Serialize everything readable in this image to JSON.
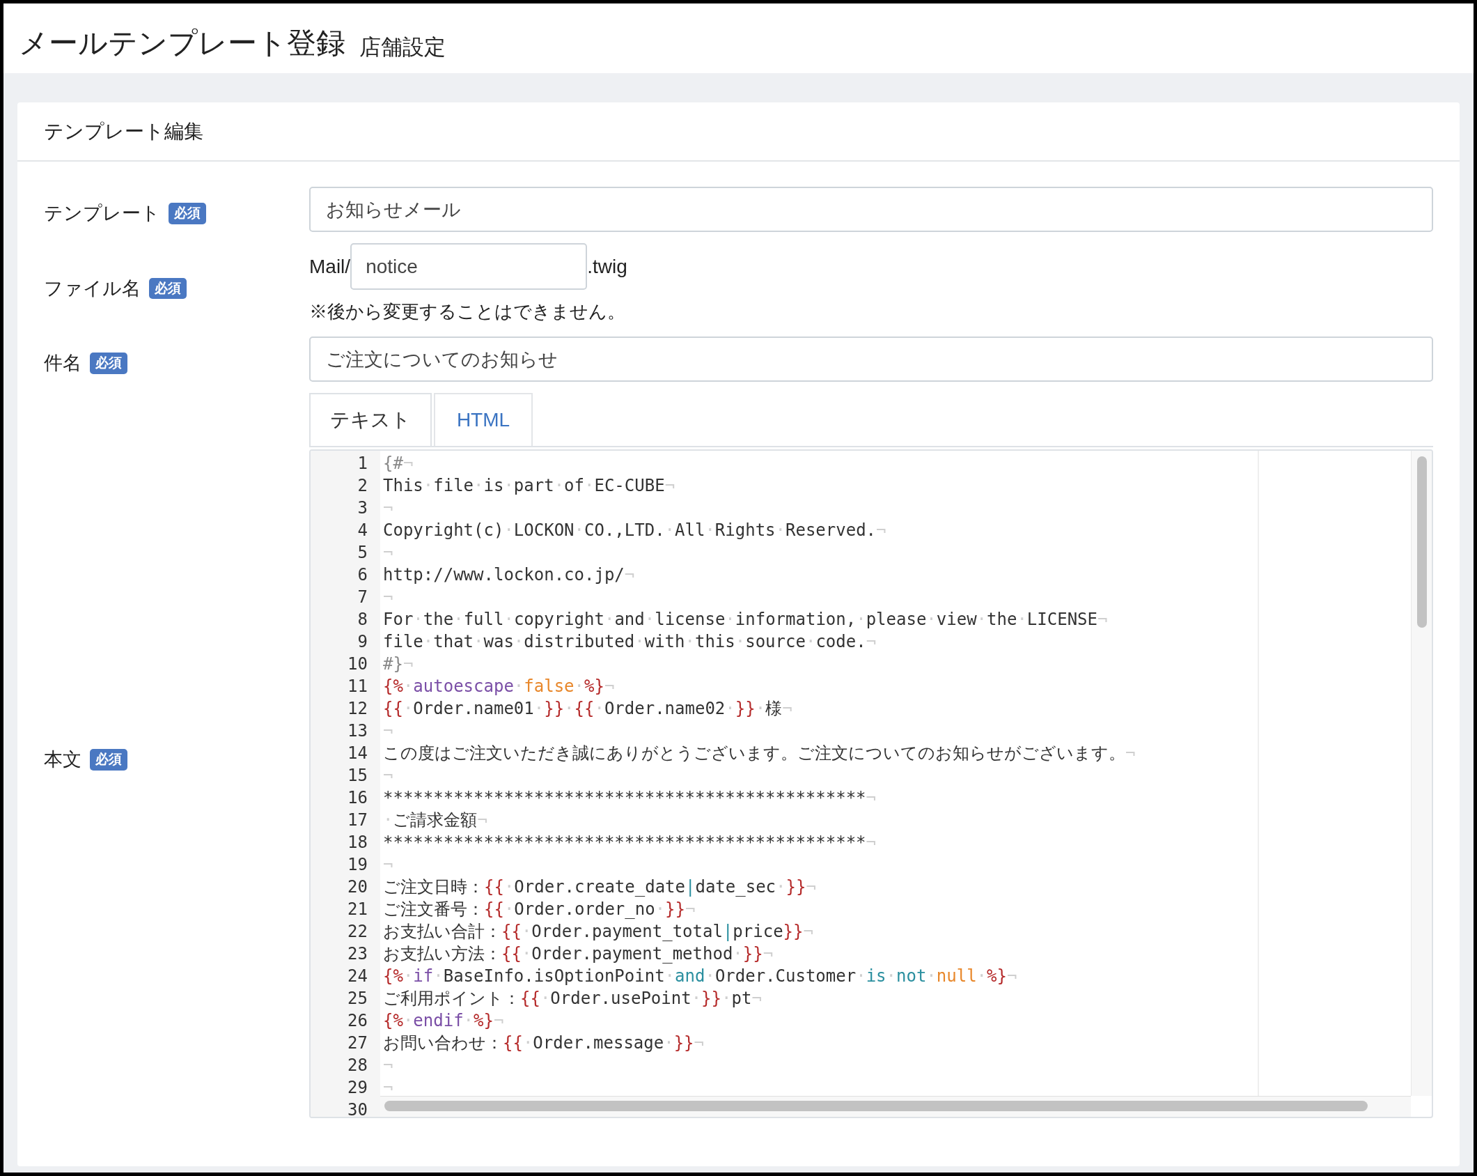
{
  "header": {
    "title": "メールテンプレート登録",
    "subtitle": "店舗設定"
  },
  "card": {
    "title": "テンプレート編集"
  },
  "form": {
    "template": {
      "label": "テンプレート",
      "badge": "必須",
      "value": "お知らせメール"
    },
    "file_name": {
      "label": "ファイル名",
      "badge": "必須",
      "prefix": "Mail/",
      "value": "notice",
      "suffix": ".twig",
      "note": "※後から変更することはできません。"
    },
    "subject": {
      "label": "件名",
      "badge": "必須",
      "value": "ご注文についてのお知らせ"
    },
    "body": {
      "label": "本文",
      "badge": "必須",
      "tabs": [
        {
          "label": "テキスト",
          "selected": true
        },
        {
          "label": "HTML",
          "selected": false
        }
      ],
      "editor": {
        "lines": [
          {
            "number": "1",
            "tokens": [
              {
                "kind": "comment",
                "text": "{#"
              },
              {
                "kind": "plain",
                "text": "¬"
              }
            ]
          },
          {
            "number": "2",
            "tokens": [
              {
                "kind": "plain",
                "text": "This·file·is·part·of·EC-CUBE¬"
              }
            ]
          },
          {
            "number": "3",
            "tokens": [
              {
                "kind": "plain",
                "text": "¬"
              }
            ]
          },
          {
            "number": "4",
            "tokens": [
              {
                "kind": "plain",
                "text": "Copyright(c)·LOCKON·CO.,LTD.·All·Rights·Reserved.¬"
              }
            ]
          },
          {
            "number": "5",
            "tokens": [
              {
                "kind": "plain",
                "text": "¬"
              }
            ]
          },
          {
            "number": "6",
            "tokens": [
              {
                "kind": "plain",
                "text": "http://www.lockon.co.jp/¬"
              }
            ]
          },
          {
            "number": "7",
            "tokens": [
              {
                "kind": "plain",
                "text": "¬"
              }
            ]
          },
          {
            "number": "8",
            "tokens": [
              {
                "kind": "plain",
                "text": "For·the·full·copyright·and·license·information,·please·view·the·LICENSE¬"
              }
            ]
          },
          {
            "number": "9",
            "tokens": [
              {
                "kind": "plain",
                "text": "file·that·was·distributed·with·this·source·code.¬"
              }
            ]
          },
          {
            "number": "10",
            "tokens": [
              {
                "kind": "comment",
                "text": "#}"
              },
              {
                "kind": "plain",
                "text": "¬"
              }
            ]
          },
          {
            "number": "11",
            "tokens": [
              {
                "kind": "delimiter",
                "text": "{%"
              },
              {
                "kind": "plain",
                "text": "·"
              },
              {
                "kind": "keyword",
                "text": "autoescape"
              },
              {
                "kind": "plain",
                "text": "·"
              },
              {
                "kind": "literal",
                "text": "false"
              },
              {
                "kind": "plain",
                "text": "·"
              },
              {
                "kind": "delimiter",
                "text": "%}"
              },
              {
                "kind": "plain",
                "text": "¬"
              }
            ]
          },
          {
            "number": "12",
            "tokens": [
              {
                "kind": "delimiter",
                "text": "{{"
              },
              {
                "kind": "plain",
                "text": "·Order.name01·"
              },
              {
                "kind": "delimiter",
                "text": "}}"
              },
              {
                "kind": "plain",
                "text": "·"
              },
              {
                "kind": "delimiter",
                "text": "{{"
              },
              {
                "kind": "plain",
                "text": "·Order.name02·"
              },
              {
                "kind": "delimiter",
                "text": "}}"
              },
              {
                "kind": "plain",
                "text": "·様¬"
              }
            ]
          },
          {
            "number": "13",
            "tokens": [
              {
                "kind": "plain",
                "text": "¬"
              }
            ]
          },
          {
            "number": "14",
            "tokens": [
              {
                "kind": "plain",
                "text": "この度はご注文いただき誠にありがとうございます。ご注文についてのお知らせがございます。¬"
              }
            ]
          },
          {
            "number": "15",
            "tokens": [
              {
                "kind": "plain",
                "text": "¬"
              }
            ]
          },
          {
            "number": "16",
            "tokens": [
              {
                "kind": "plain",
                "text": "************************************************¬"
              }
            ]
          },
          {
            "number": "17",
            "tokens": [
              {
                "kind": "plain",
                "text": "·ご請求金額¬"
              }
            ]
          },
          {
            "number": "18",
            "tokens": [
              {
                "kind": "plain",
                "text": "************************************************¬"
              }
            ]
          },
          {
            "number": "19",
            "tokens": [
              {
                "kind": "plain",
                "text": "¬"
              }
            ]
          },
          {
            "number": "20",
            "tokens": [
              {
                "kind": "plain",
                "text": "ご注文日時："
              },
              {
                "kind": "delimiter",
                "text": "{{"
              },
              {
                "kind": "plain",
                "text": "·Order.create_date"
              },
              {
                "kind": "operator",
                "text": "|"
              },
              {
                "kind": "plain",
                "text": "date_sec·"
              },
              {
                "kind": "delimiter",
                "text": "}}"
              },
              {
                "kind": "plain",
                "text": "¬"
              }
            ]
          },
          {
            "number": "21",
            "tokens": [
              {
                "kind": "plain",
                "text": "ご注文番号："
              },
              {
                "kind": "delimiter",
                "text": "{{"
              },
              {
                "kind": "plain",
                "text": "·Order.order_no·"
              },
              {
                "kind": "delimiter",
                "text": "}}"
              },
              {
                "kind": "plain",
                "text": "¬"
              }
            ]
          },
          {
            "number": "22",
            "tokens": [
              {
                "kind": "plain",
                "text": "お支払い合計："
              },
              {
                "kind": "delimiter",
                "text": "{{"
              },
              {
                "kind": "plain",
                "text": "·Order.payment_total"
              },
              {
                "kind": "operator",
                "text": "|"
              },
              {
                "kind": "plain",
                "text": "price"
              },
              {
                "kind": "delimiter",
                "text": "}}"
              },
              {
                "kind": "plain",
                "text": "¬"
              }
            ]
          },
          {
            "number": "23",
            "tokens": [
              {
                "kind": "plain",
                "text": "お支払い方法："
              },
              {
                "kind": "delimiter",
                "text": "{{"
              },
              {
                "kind": "plain",
                "text": "·Order.payment_method·"
              },
              {
                "kind": "delimiter",
                "text": "}}"
              },
              {
                "kind": "plain",
                "text": "¬"
              }
            ]
          },
          {
            "number": "24",
            "tokens": [
              {
                "kind": "delimiter",
                "text": "{%"
              },
              {
                "kind": "plain",
                "text": "·"
              },
              {
                "kind": "keyword",
                "text": "if"
              },
              {
                "kind": "plain",
                "text": "·BaseInfo.isOptionPoint·"
              },
              {
                "kind": "operator",
                "text": "and"
              },
              {
                "kind": "plain",
                "text": "·Order.Customer·"
              },
              {
                "kind": "operator",
                "text": "is"
              },
              {
                "kind": "plain",
                "text": "·"
              },
              {
                "kind": "operator",
                "text": "not"
              },
              {
                "kind": "plain",
                "text": "·"
              },
              {
                "kind": "literal",
                "text": "null"
              },
              {
                "kind": "plain",
                "text": "·"
              },
              {
                "kind": "delimiter",
                "text": "%}"
              },
              {
                "kind": "plain",
                "text": "¬"
              }
            ]
          },
          {
            "number": "25",
            "tokens": [
              {
                "kind": "plain",
                "text": "ご利用ポイント："
              },
              {
                "kind": "delimiter",
                "text": "{{"
              },
              {
                "kind": "plain",
                "text": "·Order.usePoint·"
              },
              {
                "kind": "delimiter",
                "text": "}}"
              },
              {
                "kind": "plain",
                "text": "·pt¬"
              }
            ]
          },
          {
            "number": "26",
            "tokens": [
              {
                "kind": "delimiter",
                "text": "{%"
              },
              {
                "kind": "plain",
                "text": "·"
              },
              {
                "kind": "keyword",
                "text": "endif"
              },
              {
                "kind": "plain",
                "text": "·"
              },
              {
                "kind": "delimiter",
                "text": "%}"
              },
              {
                "kind": "plain",
                "text": "¬"
              }
            ]
          },
          {
            "number": "27",
            "tokens": [
              {
                "kind": "plain",
                "text": "お問い合わせ："
              },
              {
                "kind": "delimiter",
                "text": "{{"
              },
              {
                "kind": "plain",
                "text": "·Order.message·"
              },
              {
                "kind": "delimiter",
                "text": "}}"
              },
              {
                "kind": "plain",
                "text": "¬"
              }
            ]
          },
          {
            "number": "28",
            "tokens": [
              {
                "kind": "plain",
                "text": "¬"
              }
            ]
          },
          {
            "number": "29",
            "tokens": [
              {
                "kind": "plain",
                "text": "¬"
              }
            ]
          },
          {
            "number": "30"
          }
        ]
      }
    }
  }
}
